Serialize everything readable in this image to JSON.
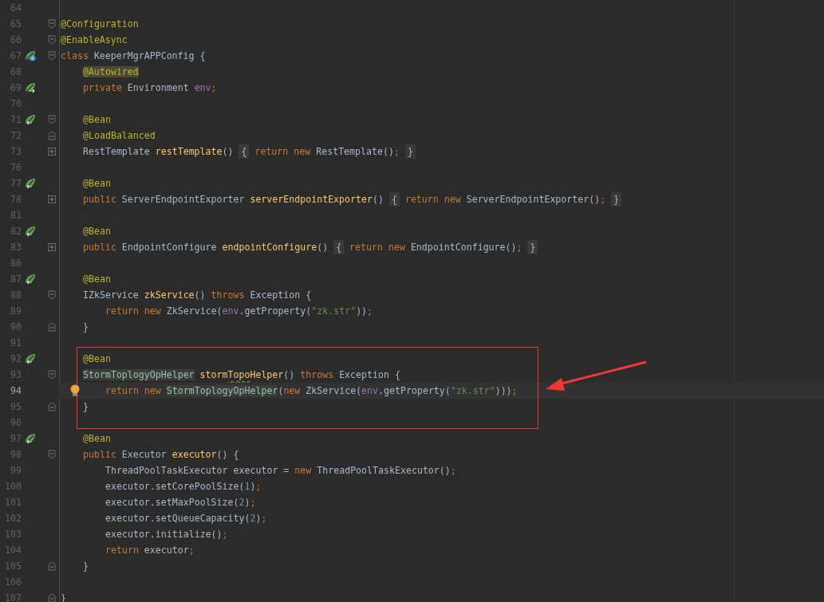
{
  "editor": {
    "lines": [
      {
        "number": "64"
      },
      {
        "number": "65",
        "fold": {
          "kind": "open"
        },
        "tokens": [
          {
            "text": "@Configuration",
            "kind": "ann"
          }
        ]
      },
      {
        "number": "66",
        "fold": {
          "kind": "open"
        },
        "tokens": [
          {
            "text": "@EnableAsync",
            "kind": "ann"
          }
        ]
      },
      {
        "number": "67",
        "gutter_icon": {
          "kind": "leaf-globe"
        },
        "fold": {
          "kind": "open"
        },
        "tokens": [
          {
            "text": "class",
            "kind": "kw"
          },
          {
            "text": " KeeperMgrAPPConfig {",
            "kind": "plain"
          }
        ]
      },
      {
        "number": "68",
        "indent": {
          "kind": "one"
        },
        "tokens": [
          {
            "text": "@Autowired",
            "kind": "ann-hl"
          }
        ]
      },
      {
        "number": "69",
        "gutter_icon": {
          "kind": "leaf-out"
        },
        "indent": {
          "kind": "one"
        },
        "tokens": [
          {
            "text": "private",
            "kind": "kw"
          },
          {
            "text": " Environment ",
            "kind": "plain"
          },
          {
            "text": "env",
            "kind": "field"
          },
          {
            "text": ";",
            "kind": "kw"
          }
        ]
      },
      {
        "number": "70"
      },
      {
        "number": "71",
        "gutter_icon": {
          "kind": "leaf-in"
        },
        "fold": {
          "kind": "open"
        },
        "indent": {
          "kind": "one"
        },
        "tokens": [
          {
            "text": "@Bean",
            "kind": "ann"
          }
        ]
      },
      {
        "number": "72",
        "fold": {
          "kind": "close"
        },
        "indent": {
          "kind": "one"
        },
        "tokens": [
          {
            "text": "@LoadBalanced",
            "kind": "ann"
          }
        ]
      },
      {
        "number": "73",
        "fold": {
          "kind": "folded"
        },
        "indent": {
          "kind": "one"
        },
        "tokens": [
          {
            "text": "RestTemplate ",
            "kind": "plain"
          },
          {
            "text": "restTemplate",
            "kind": "method"
          },
          {
            "text": "() ",
            "kind": "plain"
          },
          {
            "text": "{",
            "kind": "folded"
          },
          {
            "text": " return new",
            "kind": "kw"
          },
          {
            "text": " RestTemplate()",
            "kind": "plain"
          },
          {
            "text": "; ",
            "kind": "kw"
          },
          {
            "text": "}",
            "kind": "folded"
          }
        ]
      },
      {
        "number": "76"
      },
      {
        "number": "77",
        "gutter_icon": {
          "kind": "leaf-in"
        },
        "indent": {
          "kind": "one"
        },
        "tokens": [
          {
            "text": "@Bean",
            "kind": "ann"
          }
        ]
      },
      {
        "number": "78",
        "fold": {
          "kind": "folded"
        },
        "indent": {
          "kind": "one"
        },
        "tokens": [
          {
            "text": "public",
            "kind": "kw"
          },
          {
            "text": " ServerEndpointExporter ",
            "kind": "plain"
          },
          {
            "text": "serverEndpointExporter",
            "kind": "method"
          },
          {
            "text": "() ",
            "kind": "plain"
          },
          {
            "text": "{",
            "kind": "folded"
          },
          {
            "text": " return new",
            "kind": "kw"
          },
          {
            "text": " ServerEndpointExporter()",
            "kind": "plain"
          },
          {
            "text": "; ",
            "kind": "kw"
          },
          {
            "text": "}",
            "kind": "folded"
          }
        ]
      },
      {
        "number": "81"
      },
      {
        "number": "82",
        "gutter_icon": {
          "kind": "leaf-in"
        },
        "indent": {
          "kind": "one"
        },
        "tokens": [
          {
            "text": "@Bean",
            "kind": "ann"
          }
        ]
      },
      {
        "number": "83",
        "fold": {
          "kind": "folded"
        },
        "indent": {
          "kind": "one"
        },
        "tokens": [
          {
            "text": "public",
            "kind": "kw"
          },
          {
            "text": " EndpointConfigure ",
            "kind": "plain"
          },
          {
            "text": "endpointConfigure",
            "kind": "method"
          },
          {
            "text": "() ",
            "kind": "plain"
          },
          {
            "text": "{",
            "kind": "folded"
          },
          {
            "text": " return new",
            "kind": "kw"
          },
          {
            "text": " EndpointConfigure()",
            "kind": "plain"
          },
          {
            "text": "; ",
            "kind": "kw"
          },
          {
            "text": "}",
            "kind": "folded"
          }
        ]
      },
      {
        "number": "86"
      },
      {
        "number": "87",
        "gutter_icon": {
          "kind": "leaf-in"
        },
        "indent": {
          "kind": "one"
        },
        "tokens": [
          {
            "text": "@Bean",
            "kind": "ann"
          }
        ]
      },
      {
        "number": "88",
        "fold": {
          "kind": "open"
        },
        "indent": {
          "kind": "one"
        },
        "tokens": [
          {
            "text": "IZkService ",
            "kind": "plain"
          },
          {
            "text": "zkService",
            "kind": "method"
          },
          {
            "text": "() ",
            "kind": "plain"
          },
          {
            "text": "throws",
            "kind": "kw"
          },
          {
            "text": " Exception {",
            "kind": "plain"
          }
        ]
      },
      {
        "number": "89",
        "indent": {
          "kind": "two"
        },
        "tokens": [
          {
            "text": "return new",
            "kind": "kw"
          },
          {
            "text": " ZkService(",
            "kind": "plain"
          },
          {
            "text": "env",
            "kind": "field"
          },
          {
            "text": ".getProperty(",
            "kind": "plain"
          },
          {
            "text": "\"zk.str\"",
            "kind": "str"
          },
          {
            "text": "))",
            "kind": "plain"
          },
          {
            "text": ";",
            "kind": "kw"
          }
        ]
      },
      {
        "number": "90",
        "fold": {
          "kind": "close"
        },
        "indent": {
          "kind": "one"
        },
        "tokens": [
          {
            "text": "}",
            "kind": "plain"
          }
        ]
      },
      {
        "number": "91"
      },
      {
        "number": "92",
        "gutter_icon": {
          "kind": "leaf-in"
        },
        "indent": {
          "kind": "one"
        },
        "tokens": [
          {
            "text": "@Bean",
            "kind": "ann"
          }
        ]
      },
      {
        "number": "93",
        "fold": {
          "kind": "open"
        },
        "indent": {
          "kind": "one"
        },
        "tokens": [
          {
            "text": "StormToplogyOpHelper",
            "kind": "usage"
          },
          {
            "text": " storm",
            "kind": "method"
          },
          {
            "text": "Topo",
            "kind": "typo"
          },
          {
            "text": "Helper",
            "kind": "method"
          },
          {
            "text": "() ",
            "kind": "plain"
          },
          {
            "text": "throws",
            "kind": "kw"
          },
          {
            "text": " Exception {",
            "kind": "plain"
          }
        ]
      },
      {
        "number": "94",
        "current": true,
        "bulb": true,
        "indent": {
          "kind": "two"
        },
        "tokens": [
          {
            "text": "return new ",
            "kind": "kw"
          },
          {
            "text": "StormToplogyOpHelper",
            "kind": "usage"
          },
          {
            "text": "(",
            "kind": "plain"
          },
          {
            "text": "new",
            "kind": "kw"
          },
          {
            "text": " ZkService(",
            "kind": "plain"
          },
          {
            "text": "env",
            "kind": "field"
          },
          {
            "text": ".getProperty(",
            "kind": "plain"
          },
          {
            "text": "\"zk.str\"",
            "kind": "str"
          },
          {
            "text": ")))",
            "kind": "plain"
          },
          {
            "text": ";",
            "kind": "kw"
          }
        ]
      },
      {
        "number": "95",
        "fold": {
          "kind": "close"
        },
        "indent": {
          "kind": "one"
        },
        "tokens": [
          {
            "text": "}",
            "kind": "plain"
          }
        ]
      },
      {
        "number": "96"
      },
      {
        "number": "97",
        "gutter_icon": {
          "kind": "leaf-in"
        },
        "indent": {
          "kind": "one"
        },
        "tokens": [
          {
            "text": "@Bean",
            "kind": "ann"
          }
        ]
      },
      {
        "number": "98",
        "fold": {
          "kind": "open"
        },
        "indent": {
          "kind": "one"
        },
        "tokens": [
          {
            "text": "public",
            "kind": "kw"
          },
          {
            "text": " Executor ",
            "kind": "plain"
          },
          {
            "text": "executor",
            "kind": "method"
          },
          {
            "text": "() {",
            "kind": "plain"
          }
        ]
      },
      {
        "number": "99",
        "indent": {
          "kind": "two"
        },
        "tokens": [
          {
            "text": "ThreadPoolTaskExecutor executor = ",
            "kind": "plain"
          },
          {
            "text": "new",
            "kind": "kw"
          },
          {
            "text": " ThreadPoolTaskExecutor()",
            "kind": "plain"
          },
          {
            "text": ";",
            "kind": "kw"
          }
        ]
      },
      {
        "number": "100",
        "indent": {
          "kind": "two"
        },
        "tokens": [
          {
            "text": "executor.setCorePoolSize(",
            "kind": "plain"
          },
          {
            "text": "1",
            "kind": "num"
          },
          {
            "text": ")",
            "kind": "plain"
          },
          {
            "text": ";",
            "kind": "kw"
          }
        ]
      },
      {
        "number": "101",
        "indent": {
          "kind": "two"
        },
        "tokens": [
          {
            "text": "executor.setMaxPoolSize(",
            "kind": "plain"
          },
          {
            "text": "2",
            "kind": "num"
          },
          {
            "text": ")",
            "kind": "plain"
          },
          {
            "text": ";",
            "kind": "kw"
          }
        ]
      },
      {
        "number": "102",
        "indent": {
          "kind": "two"
        },
        "tokens": [
          {
            "text": "executor.setQueueCapacity(",
            "kind": "plain"
          },
          {
            "text": "2",
            "kind": "num"
          },
          {
            "text": ")",
            "kind": "plain"
          },
          {
            "text": ";",
            "kind": "kw"
          }
        ]
      },
      {
        "number": "103",
        "indent": {
          "kind": "two"
        },
        "tokens": [
          {
            "text": "executor.initialize()",
            "kind": "plain"
          },
          {
            "text": ";",
            "kind": "kw"
          }
        ]
      },
      {
        "number": "104",
        "indent": {
          "kind": "two"
        },
        "tokens": [
          {
            "text": "return",
            "kind": "kw"
          },
          {
            "text": " executor",
            "kind": "plain"
          },
          {
            "text": ";",
            "kind": "kw"
          }
        ]
      },
      {
        "number": "105",
        "fold": {
          "kind": "close"
        },
        "indent": {
          "kind": "one"
        },
        "tokens": [
          {
            "text": "}",
            "kind": "plain"
          }
        ]
      },
      {
        "number": "106"
      },
      {
        "number": "107",
        "fold": {
          "kind": "close"
        },
        "tokens": [
          {
            "text": "}",
            "kind": "plain"
          }
        ]
      }
    ]
  }
}
